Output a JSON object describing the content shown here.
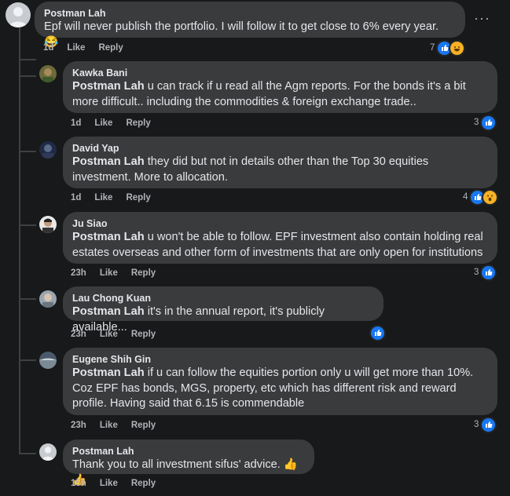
{
  "comments": [
    {
      "author": "Postman Lah",
      "mention": "",
      "text": "Epf will never publish the portfolio. I will follow it to get close to 6% every year. 😂",
      "time": "1d",
      "like": "Like",
      "reply": "Reply",
      "reaction_count": "7",
      "reactions": [
        "like-icon",
        "haha-icon"
      ]
    },
    {
      "author": "Kawka Bani",
      "mention": "Postman Lah",
      "text": " u can track if u read all the Agm reports. For the bonds it's a bit more difficult.. including the commodities & foreign exchange trade..",
      "time": "1d",
      "like": "Like",
      "reply": "Reply",
      "reaction_count": "3",
      "reactions": [
        "like-icon"
      ]
    },
    {
      "author": "David Yap",
      "mention": "Postman Lah",
      "text": " they did but not in details other than the Top 30 equities investment. More to allocation.",
      "time": "1d",
      "like": "Like",
      "reply": "Reply",
      "reaction_count": "4",
      "reactions": [
        "like-icon",
        "wow-icon"
      ]
    },
    {
      "author": "Ju Siao",
      "mention": "Postman Lah",
      "text": " u won't be able to follow. EPF investment also contain holding real estates overseas and other form of investments that are only open for institutions",
      "time": "23h",
      "like": "Like",
      "reply": "Reply",
      "reaction_count": "3",
      "reactions": [
        "like-icon"
      ]
    },
    {
      "author": "Lau Chong Kuan",
      "mention": "Postman Lah",
      "text": " it's in the annual report, it's publicly available...",
      "time": "23h",
      "like": "Like",
      "reply": "Reply",
      "reaction_count": "",
      "reactions": [
        "like-icon"
      ]
    },
    {
      "author": "Eugene Shih Gin",
      "mention": "Postman Lah",
      "text": " if u can follow the equities portion only u will get more than 10%. Coz EPF has bonds, MGS, property, etc which has different risk and reward profile. Having said that 6.15 is commendable",
      "time": "23h",
      "like": "Like",
      "reply": "Reply",
      "reaction_count": "3",
      "reactions": [
        "like-icon"
      ]
    },
    {
      "author": "Postman Lah",
      "mention": "",
      "text": "Thank you to all investment sifus' advice. 👍👍",
      "time": "15h",
      "like": "Like",
      "reply": "Reply",
      "reaction_count": "",
      "reactions": []
    }
  ],
  "more_options": "···"
}
